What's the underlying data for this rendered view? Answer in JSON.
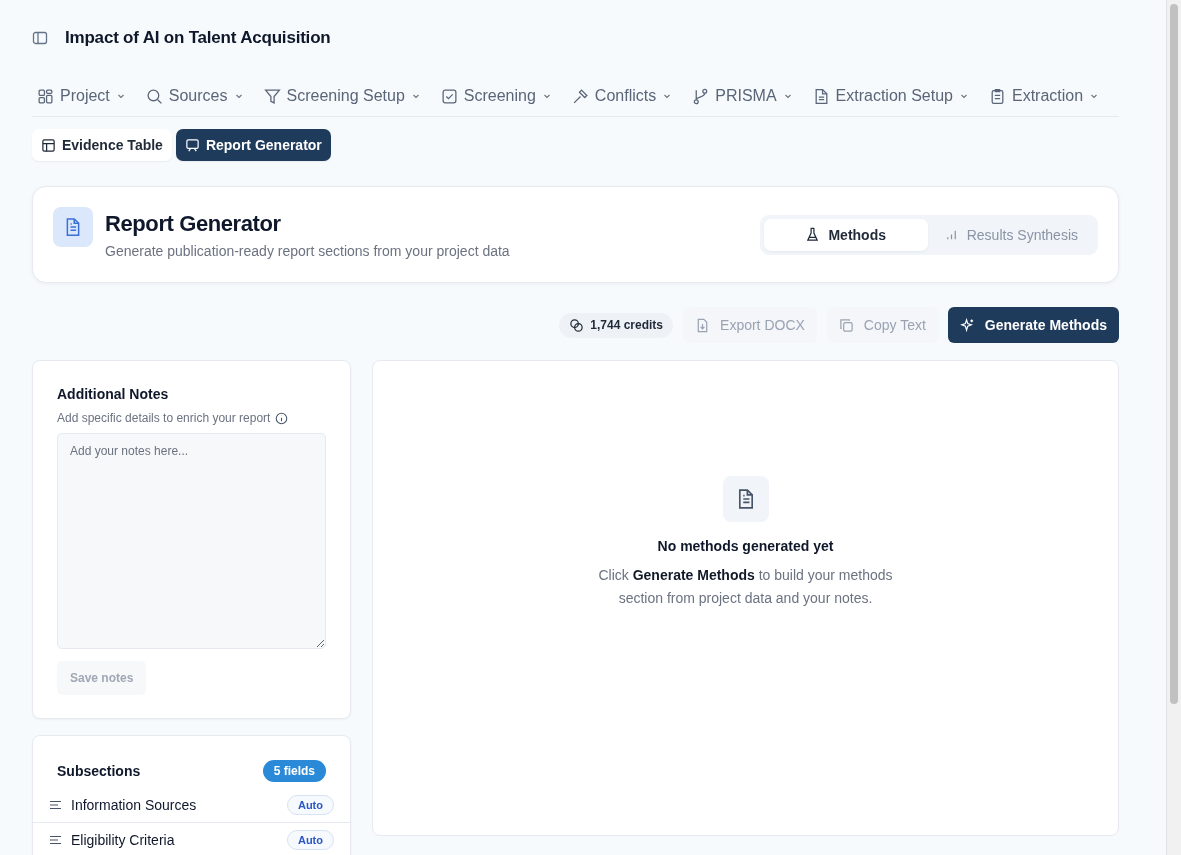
{
  "project": {
    "title": "Impact of AI on Talent Acquisition"
  },
  "nav": [
    {
      "label": "Project"
    },
    {
      "label": "Sources"
    },
    {
      "label": "Screening Setup"
    },
    {
      "label": "Screening"
    },
    {
      "label": "Conflicts"
    },
    {
      "label": "PRISMA"
    },
    {
      "label": "Extraction Setup"
    },
    {
      "label": "Extraction"
    }
  ],
  "view_tabs": [
    {
      "label": "Evidence Table",
      "selected": false
    },
    {
      "label": "Report Generator",
      "selected": true
    }
  ],
  "header": {
    "title": "Report Generator",
    "subtitle": "Generate publication-ready report sections from your project data"
  },
  "mode_tabs": [
    {
      "label": "Methods",
      "selected": true
    },
    {
      "label": "Results Synthesis",
      "selected": false
    }
  ],
  "toolbar": {
    "credits": "1,744 credits",
    "buttons": [
      {
        "label": "Export DOCX",
        "kind": "secondary",
        "disabled": true
      },
      {
        "label": "Copy Text",
        "kind": "secondary",
        "disabled": true
      },
      {
        "label": "Generate Methods",
        "kind": "primary",
        "disabled": false
      }
    ]
  },
  "notes": {
    "title": "Additional Notes",
    "hint": "Add specific details to enrich your report",
    "placeholder": "Add your notes here...",
    "save_label": "Save notes",
    "save_disabled": true
  },
  "subsections": {
    "title": "Subsections",
    "count": "5 fields",
    "items": [
      {
        "label": "Information Sources",
        "badge": "Auto"
      },
      {
        "label": "Eligibility Criteria",
        "badge": "Auto"
      }
    ]
  },
  "empty_state": {
    "title": "No methods generated yet",
    "text": "Click **Generate Methods** to build your methods section from project data and your notes."
  }
}
